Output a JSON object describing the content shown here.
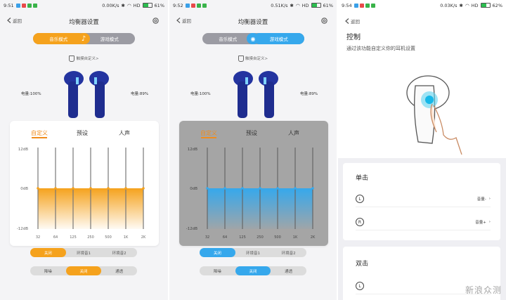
{
  "panels": [
    {
      "status": {
        "time": "9:51",
        "speed": "0.00K/s",
        "hd": "HD",
        "battery": "61%",
        "battery_level": 0.61
      },
      "back": "返回",
      "title": "均衡器设置",
      "mode": {
        "music": "音乐模式",
        "game": "游戏模式",
        "active": "music"
      },
      "hint": "触摸自定义>",
      "left_batt": "电量:100%",
      "right_batt": "电量:89%",
      "tabs": [
        "自定义",
        "预设",
        "人声"
      ],
      "eq": {
        "y_labels": [
          "12dB",
          "0dB",
          "-12dB"
        ],
        "freqs": [
          "32",
          "64",
          "125",
          "250",
          "500",
          "1K",
          "2K"
        ],
        "gains_db": [
          0,
          0,
          0,
          0,
          0,
          0,
          0
        ]
      },
      "ambient": {
        "options": [
          "关闭",
          "环境音1",
          "环境音2"
        ],
        "selected": 0
      },
      "noise": {
        "options": [
          "降噪",
          "关闭",
          "通透"
        ],
        "selected": 1
      }
    },
    {
      "status": {
        "time": "9:52",
        "speed": "0.51K/s",
        "hd": "HD",
        "battery": "61%",
        "battery_level": 0.61
      },
      "back": "返回",
      "title": "均衡器设置",
      "mode": {
        "music": "音乐模式",
        "game": "游戏模式",
        "active": "game"
      },
      "hint": "触摸自定义>",
      "left_batt": "电量:100%",
      "right_batt": "电量:89%",
      "tabs": [
        "自定义",
        "预设",
        "人声"
      ],
      "eq": {
        "y_labels": [
          "12dB",
          "0dB",
          "-12dB"
        ],
        "freqs": [
          "32",
          "64",
          "125",
          "250",
          "500",
          "1K",
          "2K"
        ],
        "gains_db": [
          0,
          0,
          0,
          0,
          0,
          0,
          0
        ]
      },
      "ambient": {
        "options": [
          "关闭",
          "环境音1",
          "环境音2"
        ],
        "selected": 0
      },
      "noise": {
        "options": [
          "降噪",
          "关闭",
          "通透"
        ],
        "selected": 1
      }
    }
  ],
  "control": {
    "status": {
      "time": "9:54",
      "speed": "0.03K/s",
      "hd": "HD",
      "battery": "62%",
      "battery_level": 0.62
    },
    "back": "返回",
    "title": "控制",
    "subtitle": "通过该功能自定义你的耳机设置",
    "single": {
      "heading": "单击",
      "rows": [
        {
          "side": "L",
          "value": "音量-"
        },
        {
          "side": "R",
          "value": "音量+"
        }
      ]
    },
    "double": {
      "heading": "双击",
      "rows": [
        {
          "side": "L",
          "value": ""
        }
      ]
    }
  },
  "colors": {
    "orange": "#f5a21d",
    "blue": "#36a8ec",
    "gray_toggle": "#9b9ba3"
  },
  "watermark": "新浪众测"
}
